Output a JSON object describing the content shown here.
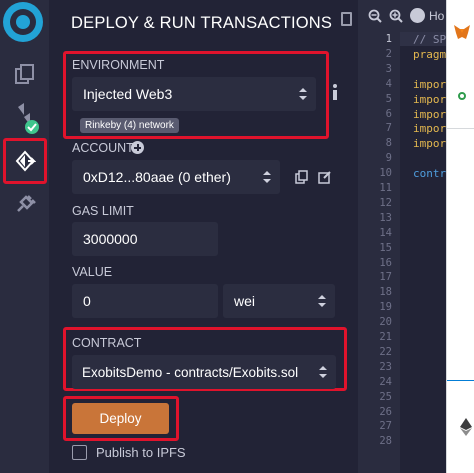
{
  "panel": {
    "title": "DEPLOY & RUN TRANSACTIONS",
    "environment": {
      "label": "ENVIRONMENT",
      "value": "Injected Web3",
      "network_badge": "Rinkeby (4) network",
      "info_icon": "info-icon"
    },
    "account": {
      "label": "ACCOUNT",
      "value": "0xD12...80aae (0 ether)"
    },
    "gas_limit": {
      "label": "GAS LIMIT",
      "value": "3000000"
    },
    "value": {
      "label": "VALUE",
      "amount": "0",
      "unit": "wei"
    },
    "contract": {
      "label": "CONTRACT",
      "value": "ExobitsDemo - contracts/Exobits.sol"
    },
    "deploy_label": "Deploy",
    "publish_label": "Publish to IPFS"
  },
  "sidebar": {
    "items": [
      "remix-logo-icon",
      "file-explorer-icon",
      "solidity-compiler-icon",
      "deploy-run-icon",
      "plugin-icon"
    ]
  },
  "editor": {
    "tab_label": "Ho",
    "line_numbers": [
      "1",
      "2",
      "3",
      "4",
      "5",
      "6",
      "7",
      "8",
      "9",
      "10",
      "11",
      "12",
      "13",
      "14",
      "15",
      "16",
      "17",
      "18",
      "19",
      "20",
      "21",
      "22",
      "23",
      "24",
      "25",
      "26",
      "27",
      "28"
    ],
    "code_lines": [
      {
        "text": "// SP",
        "color": "#8a8ca6"
      },
      {
        "text": "pragm",
        "color": "#e4b84f"
      },
      {
        "text": "",
        "color": "#c8cad8"
      },
      {
        "text": "impor",
        "color": "#e4b84f"
      },
      {
        "text": "impor",
        "color": "#e4b84f"
      },
      {
        "text": "impor",
        "color": "#e4b84f"
      },
      {
        "text": "impor",
        "color": "#e4b84f"
      },
      {
        "text": "impor",
        "color": "#e4b84f"
      },
      {
        "text": "",
        "color": "#c8cad8"
      },
      {
        "text": "contr",
        "color": "#4f9ede"
      }
    ]
  },
  "colors": {
    "accent": "#c97539",
    "highlight": "#e0132c",
    "panel_bg": "#222336"
  }
}
